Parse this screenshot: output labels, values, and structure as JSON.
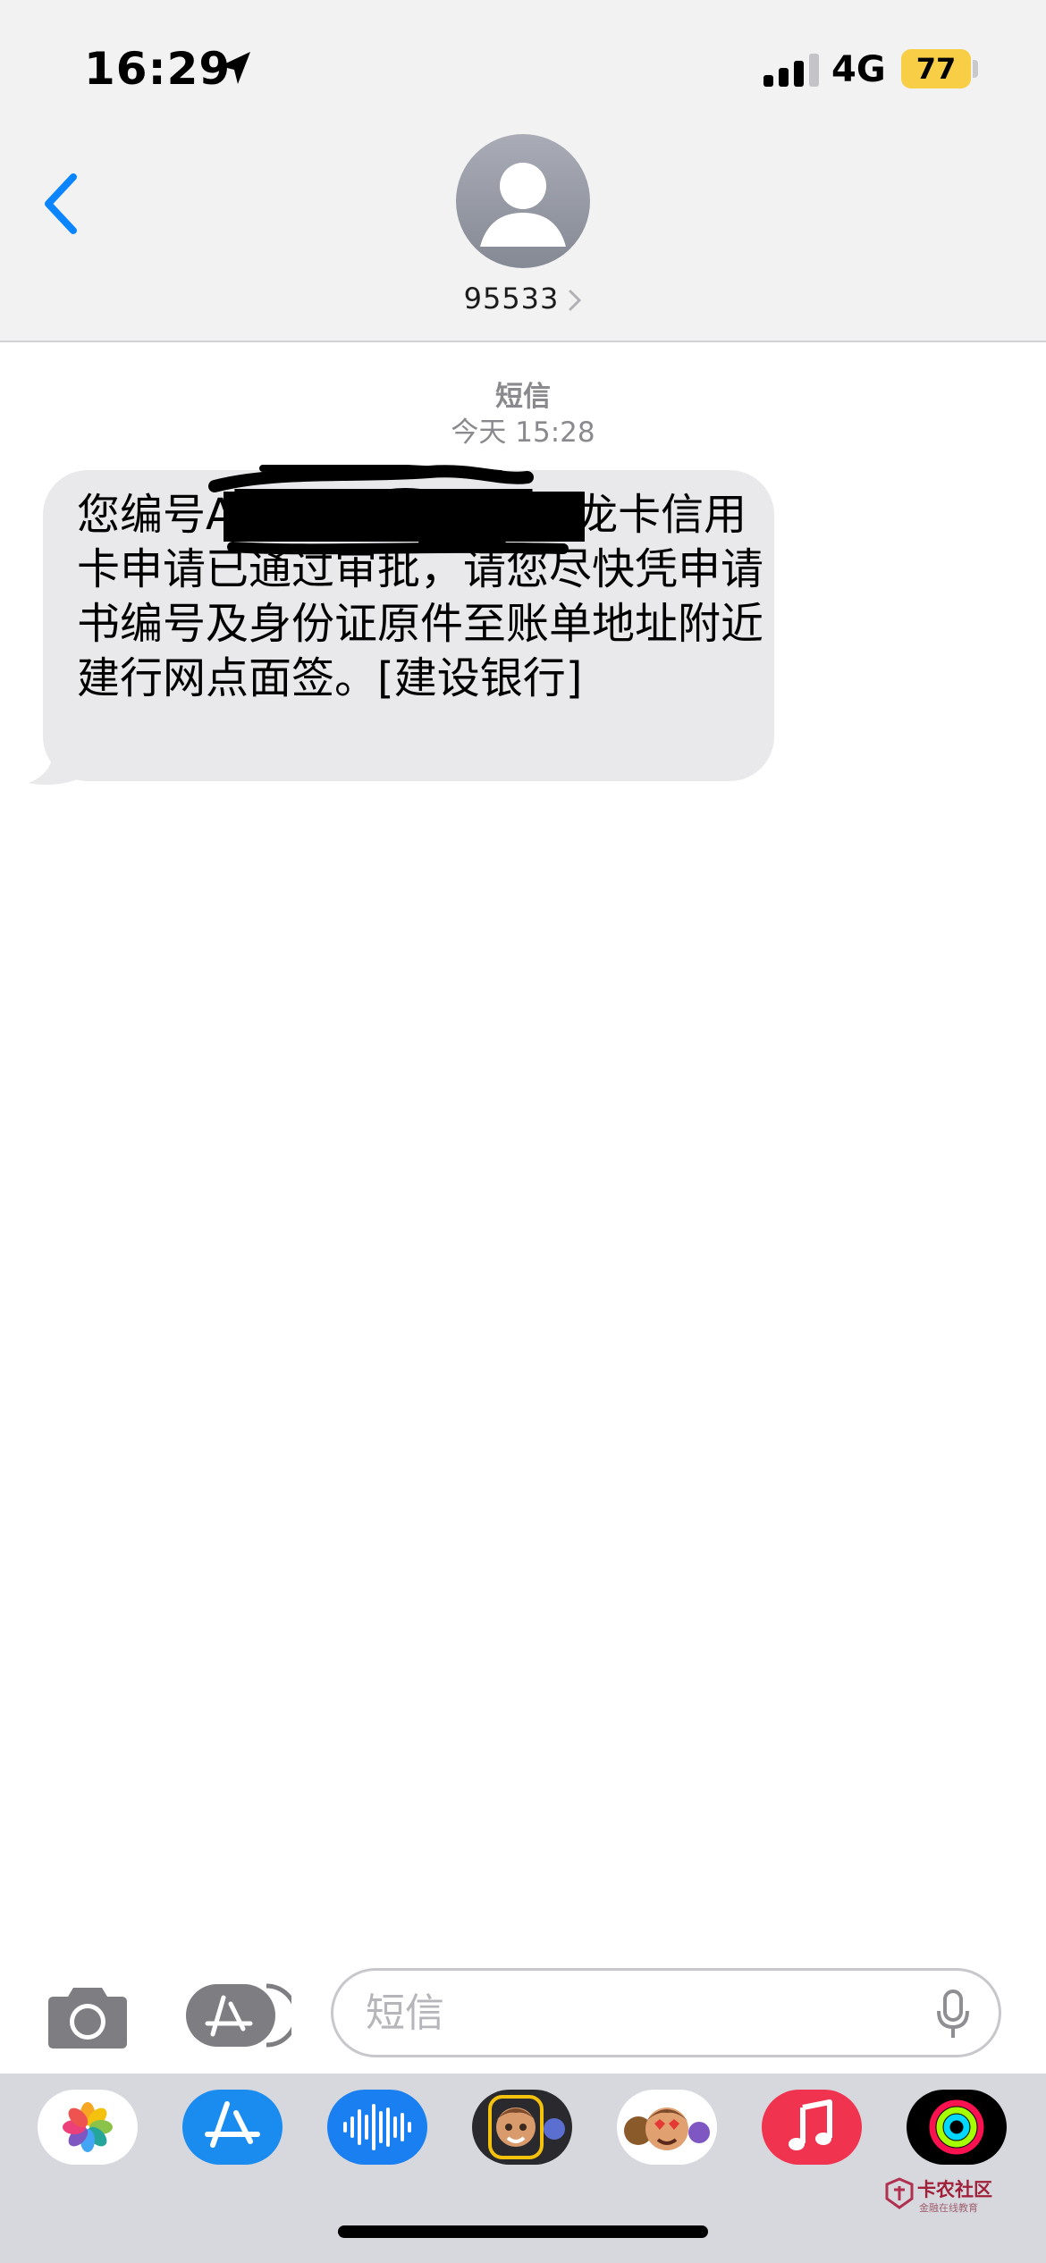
{
  "status_bar": {
    "time": "16:29",
    "network": "4G",
    "battery_level": "77",
    "battery_color": "#f7ce46"
  },
  "header": {
    "contact_number": "95533",
    "back_icon": "chevron-left-icon",
    "avatar_icon": "person-silhouette-icon"
  },
  "conversation": {
    "service_label": "短信",
    "timestamp_day": "今天",
    "timestamp_time": "15:28",
    "message": {
      "text": "您编号A█████████的龙卡信用卡申请已通过审批，请您尽快凭申请书编号及身份证原件至账单地址附近建行网点面签。[建设银行]",
      "redacted": true
    }
  },
  "compose": {
    "placeholder": "短信",
    "value": "",
    "accent_color": "#0a84ff"
  },
  "app_drawer": {
    "apps": [
      {
        "icon": "photos-app-icon"
      },
      {
        "icon": "app-store-icon"
      },
      {
        "icon": "voice-memo-icon"
      },
      {
        "icon": "memoji-sticker-icon"
      },
      {
        "icon": "animoji-sticker-icon"
      },
      {
        "icon": "music-app-icon"
      },
      {
        "icon": "activity-app-icon"
      }
    ]
  },
  "watermark": {
    "title": "卡农社区",
    "subtitle": "金融在线教育"
  }
}
